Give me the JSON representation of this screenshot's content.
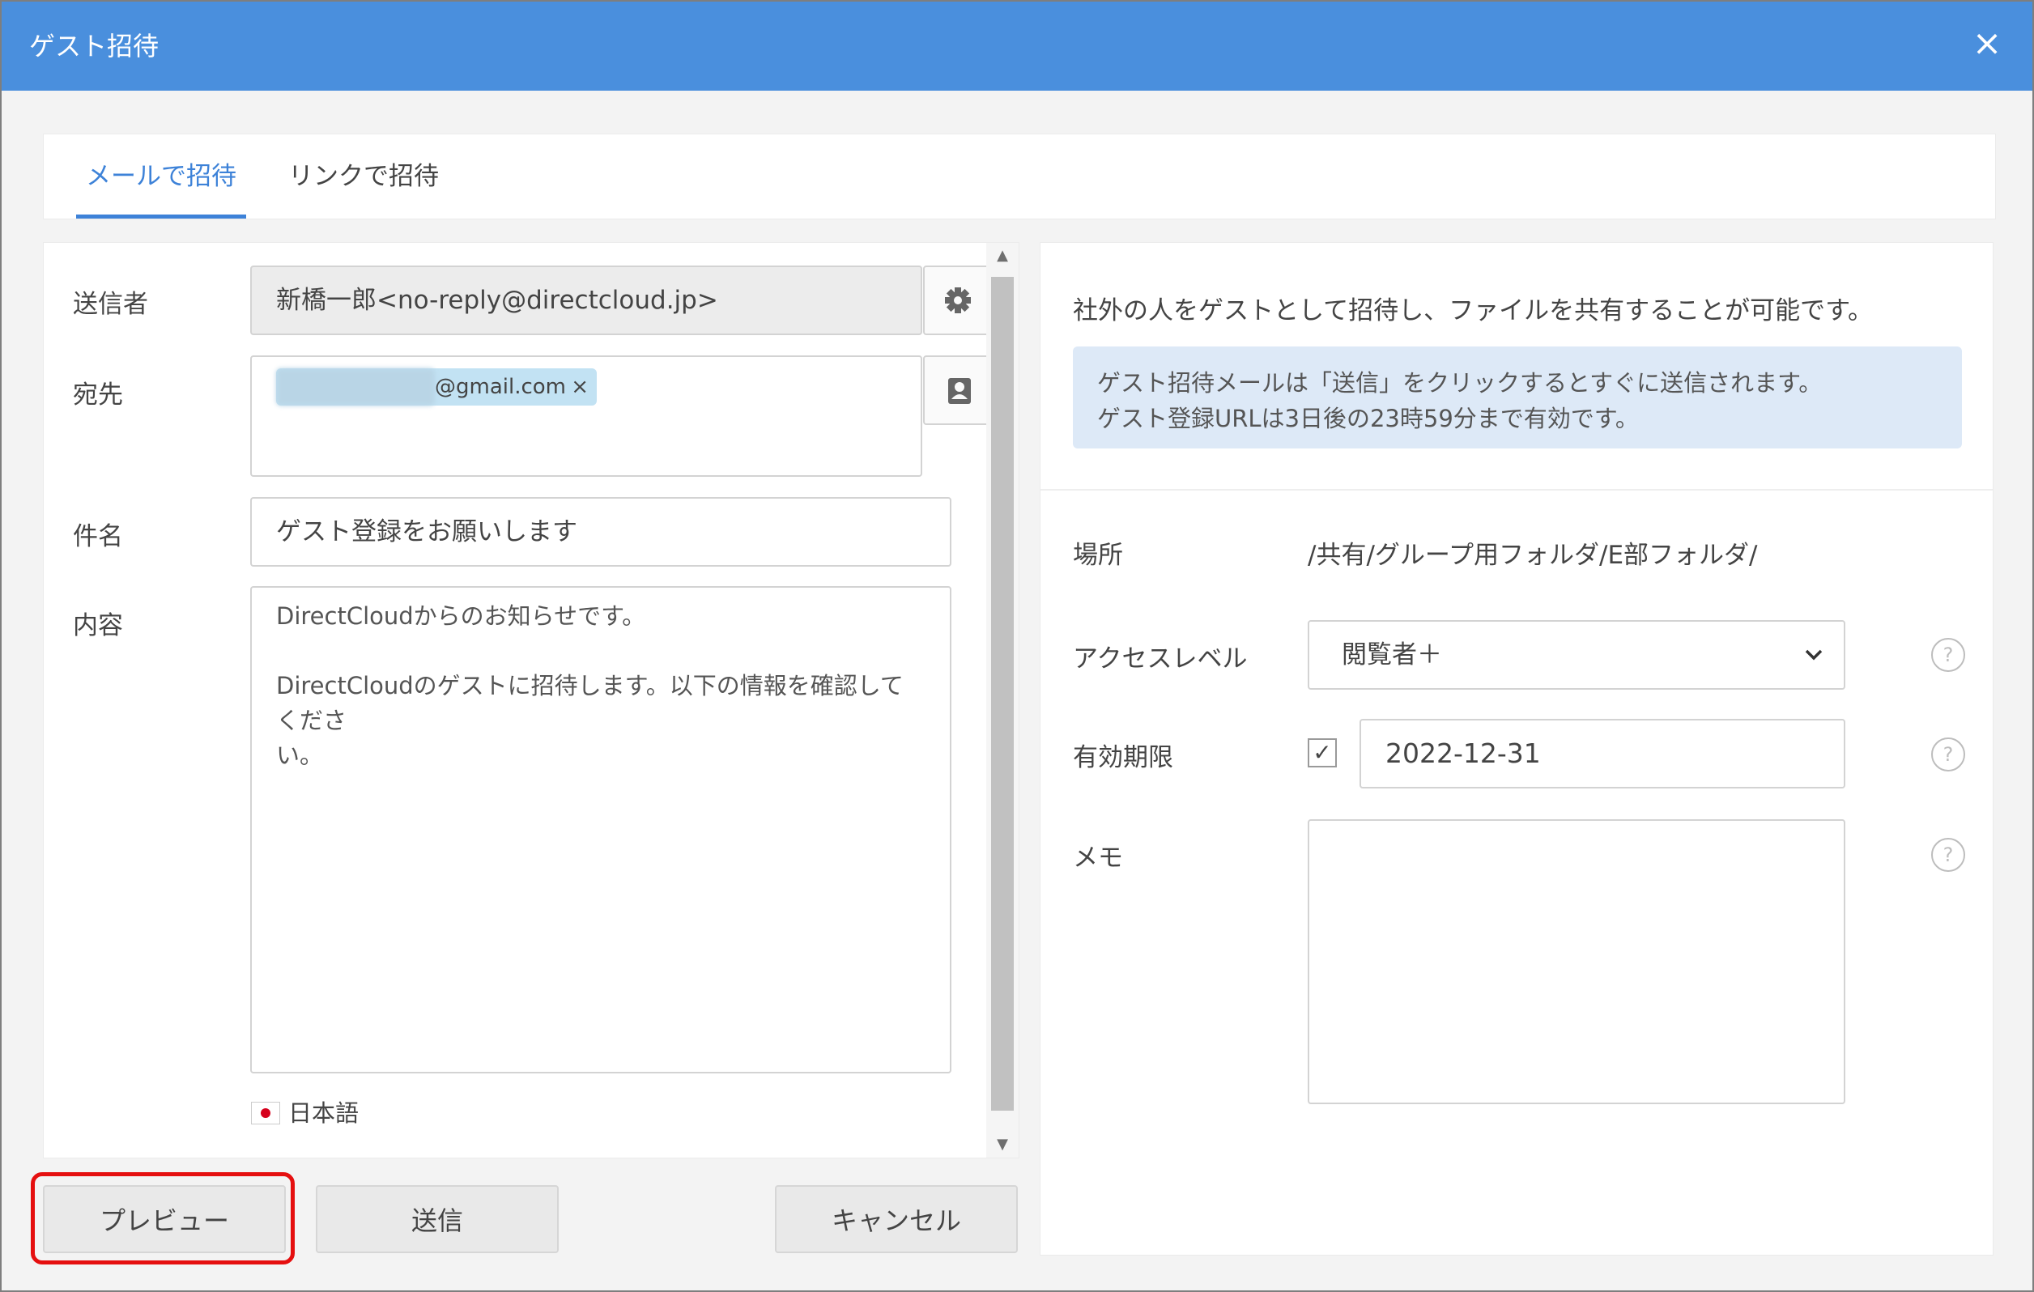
{
  "dialog": {
    "title": "ゲスト招待",
    "close_icon": "×"
  },
  "tabs": [
    {
      "label": "メールで招待",
      "active": true
    },
    {
      "label": "リンクで招待",
      "active": false
    }
  ],
  "form": {
    "sender_label": "送信者",
    "sender_value": "新橋一郎<no-reply@directcloud.jp>",
    "recipient_label": "宛先",
    "recipient_tag_domain": "@gmail.com",
    "recipient_tag_remove": "×",
    "subject_label": "件名",
    "subject_value": "ゲスト登録をお願いします",
    "content_label": "内容",
    "content_value": "DirectCloudからのお知らせです。\n\nDirectCloudのゲストに招待します。以下の情報を確認してくださ\nい。",
    "language": "日本語"
  },
  "buttons": {
    "preview": "プレビュー",
    "send": "送信",
    "cancel": "キャンセル"
  },
  "info": {
    "description": "社外の人をゲストとして招待し、ファイルを共有することが可能です。",
    "notice_line1": "ゲスト招待メールは「送信」をクリックするとすぐに送信されます。",
    "notice_line2": "ゲスト登録URLは3日後の23時59分まで有効です。",
    "location_label": "場所",
    "location_value": "/共有/グループ用フォルダ/E部フォルダ/",
    "access_label": "アクセスレベル",
    "access_value": "閲覧者＋",
    "expiry_label": "有効期限",
    "expiry_checked": true,
    "expiry_value": "2022-12-31",
    "memo_label": "メモ",
    "help": "?"
  },
  "colors": {
    "titlebar": "#4a8fdd",
    "accent": "#3d82d8",
    "highlight": "#e50f0f",
    "notice_bg": "#dde9f7"
  }
}
